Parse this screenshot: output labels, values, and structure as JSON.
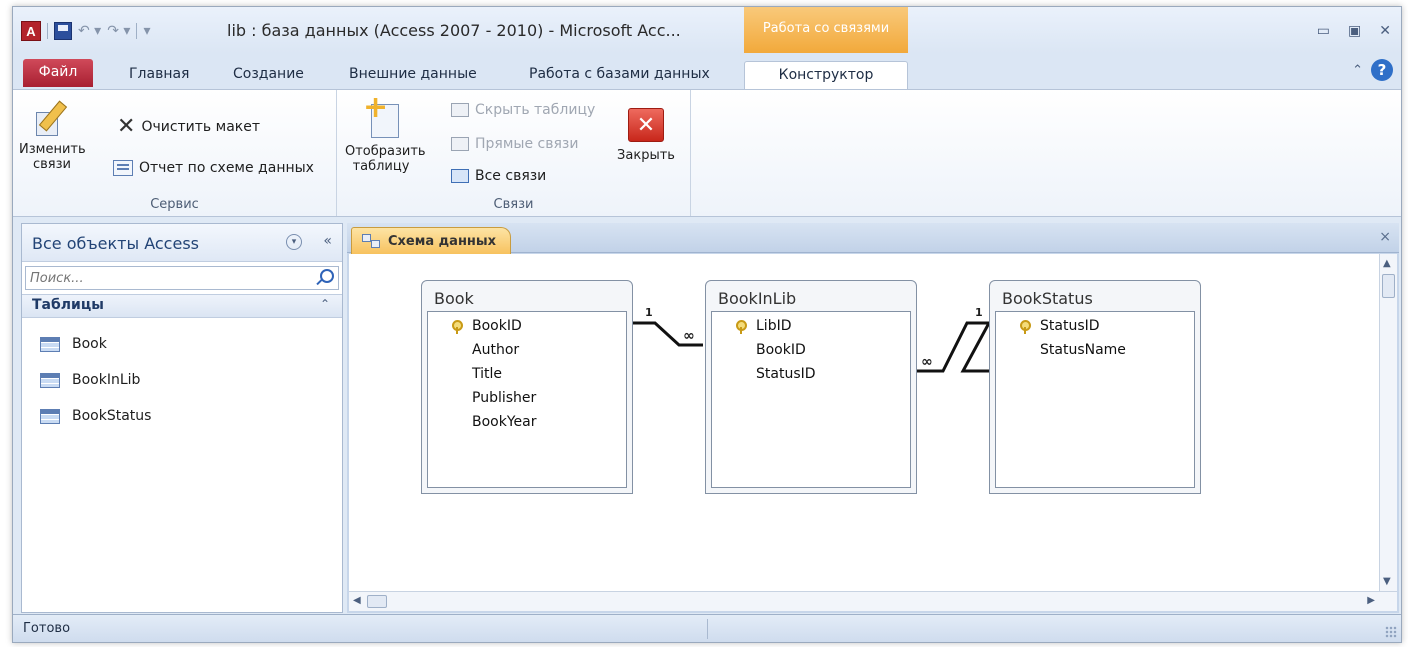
{
  "titlebar": {
    "app_icon_letter": "A",
    "title": "lib : база данных (Access 2007 - 2010)  -  Microsoft Acc...",
    "context_tab": "Работа со связями",
    "controls": {
      "minimize": "▭",
      "restore": "▣",
      "close": "✕"
    }
  },
  "tabs": {
    "file": "Файл",
    "home": "Главная",
    "create": "Создание",
    "external": "Внешние данные",
    "database": "Работа с базами данных",
    "design": "Конструктор",
    "minimize_ribbon": "⌃",
    "help": "?"
  },
  "ribbon": {
    "service": {
      "label": "Сервис",
      "edit_relationships": "Изменить связи",
      "clear_layout": "Очистить макет",
      "relationship_report": "Отчет по схеме данных"
    },
    "relationships": {
      "label": "Связи",
      "show_table": "Отобразить таблицу",
      "hide_table": "Скрыть таблицу",
      "direct_relationships": "Прямые связи",
      "all_relationships": "Все связи",
      "close": "Закрыть"
    }
  },
  "nav": {
    "title": "Все объекты Access",
    "collapse": "«",
    "search_placeholder": "Поиск...",
    "group": "Таблицы",
    "group_chevron": "⌃",
    "items": [
      "Book",
      "BookInLib",
      "BookStatus"
    ]
  },
  "document": {
    "tab_label": "Схема данных",
    "close": "×",
    "tables": [
      {
        "name": "Book",
        "fields": [
          "BookID",
          "Author",
          "Title",
          "Publisher",
          "BookYear"
        ],
        "key": "BookID"
      },
      {
        "name": "BookInLib",
        "fields": [
          "LibID",
          "BookID",
          "StatusID"
        ],
        "key": "LibID"
      },
      {
        "name": "BookStatus",
        "fields": [
          "StatusID",
          "StatusName"
        ],
        "key": "StatusID"
      }
    ],
    "relationships": [
      {
        "from": "Book.BookID",
        "to": "BookInLib.BookID",
        "one": "1",
        "many": "∞"
      },
      {
        "from": "BookStatus.StatusID",
        "to": "BookInLib.StatusID",
        "one": "1",
        "many": "∞"
      }
    ]
  },
  "status": {
    "text": "Готово"
  }
}
